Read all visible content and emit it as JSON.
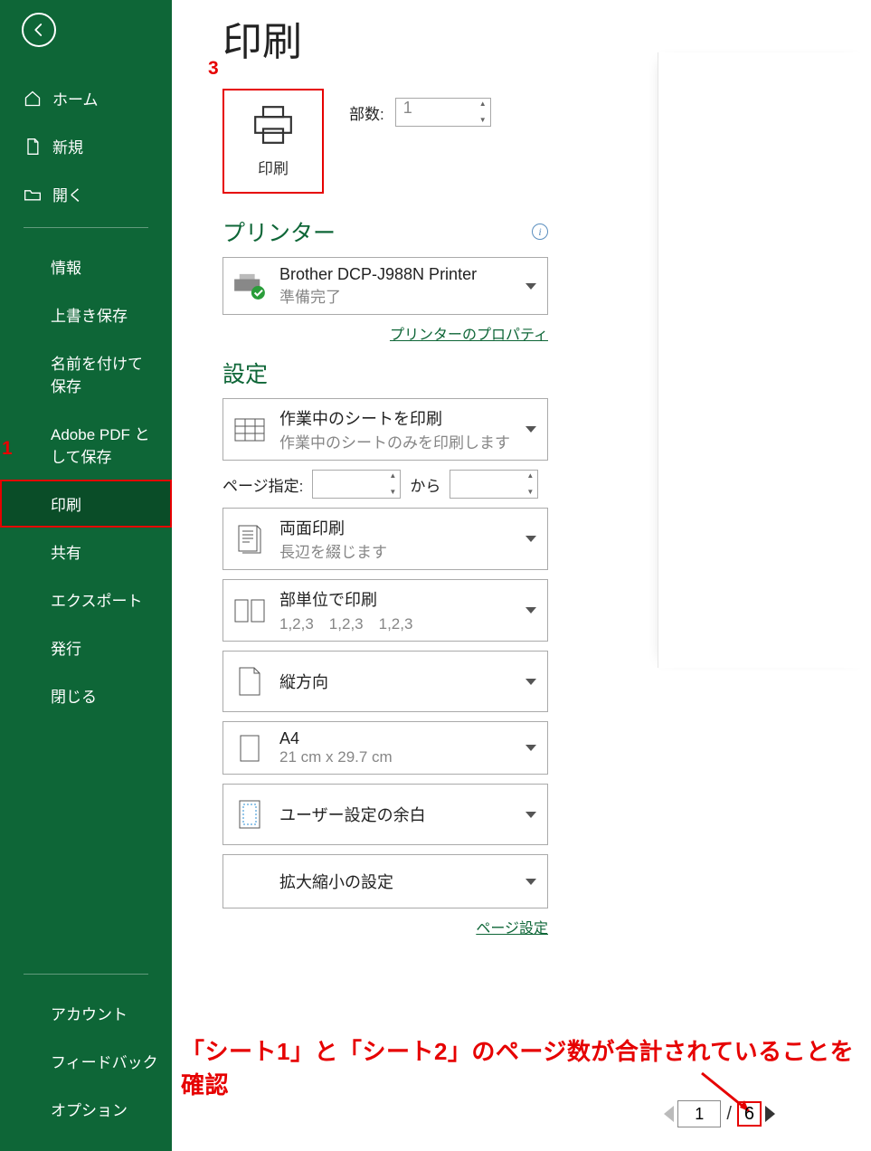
{
  "sidebar": {
    "back": "←",
    "items_primary": [
      {
        "icon": "home",
        "label": "ホーム"
      },
      {
        "icon": "new",
        "label": "新規"
      },
      {
        "icon": "open",
        "label": "開く"
      }
    ],
    "items_mid": [
      {
        "label": "情報"
      },
      {
        "label": "上書き保存"
      },
      {
        "label": "名前を付けて保存"
      },
      {
        "label": "Adobe PDF として保存"
      },
      {
        "label": "印刷",
        "selected": true
      },
      {
        "label": "共有"
      },
      {
        "label": "エクスポート"
      },
      {
        "label": "発行"
      },
      {
        "label": "閉じる"
      }
    ],
    "items_bottom": [
      {
        "label": "アカウント"
      },
      {
        "label": "フィードバック"
      },
      {
        "label": "オプション"
      }
    ]
  },
  "page_title": "印刷",
  "print_button_label": "印刷",
  "copies": {
    "label": "部数:",
    "value": "1"
  },
  "printer": {
    "section": "プリンター",
    "name": "Brother DCP-J988N Printer",
    "status": "準備完了",
    "properties_link": "プリンターのプロパティ"
  },
  "settings": {
    "section": "設定",
    "print_scope": {
      "line1": "作業中のシートを印刷",
      "line2": "作業中のシートのみを印刷します"
    },
    "pages": {
      "label": "ページ指定:",
      "from": "",
      "to_label": "から",
      "to": ""
    },
    "duplex": {
      "line1": "両面印刷",
      "line2": "長辺を綴じます"
    },
    "collate": {
      "line1": "部単位で印刷",
      "line2": "1,2,3　1,2,3　1,2,3"
    },
    "orientation": {
      "line1": "縦方向"
    },
    "paper": {
      "line1": "A4",
      "line2": "21 cm x 29.7 cm"
    },
    "margins": {
      "line1": "ユーザー設定の余白"
    },
    "scale": {
      "line1": "拡大縮小の設定"
    },
    "page_setup_link": "ページ設定"
  },
  "annotation_text": "「シート1」と「シート2」のページ数が合計されていることを確認",
  "markers": {
    "m1": "1",
    "m3": "3"
  },
  "pager": {
    "current": "1",
    "total": "6"
  }
}
